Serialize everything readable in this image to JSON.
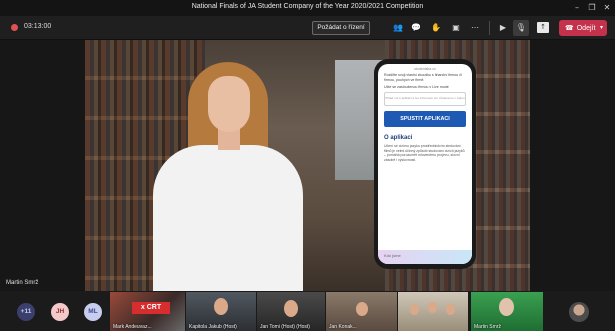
{
  "window": {
    "title": "National Finals of JA Student Company of the Year 2020/2021 Competition",
    "controls": [
      "minimize-icon",
      "restore-icon",
      "close-icon"
    ]
  },
  "toolbar": {
    "timer": "03:13:00",
    "ask_control_label": "Požádat o řízení",
    "leave_label": "Odejít",
    "icons": [
      "participants-icon",
      "chat-icon",
      "raise-hand-icon",
      "rooms-icon",
      "more-icon",
      "camera-off-icon",
      "mic-off-icon",
      "share-screen-icon",
      "phone-icon"
    ],
    "colors": {
      "leave": "#c4314b",
      "recording": "#e05252"
    }
  },
  "stage": {
    "speaker_name": "Martin Smrž"
  },
  "phone": {
    "url": "studentska.cz",
    "intro": "Rozšiřte svoji vlastní zkoušku s finanční firmou či firmou, pouhých ve firmě.",
    "subheading": "Učte se zaslouženou firmou v Live mode",
    "input_placeholder": "Přiřaď mě k aplikaci a tvé informace pro zůstaneme v zájmu",
    "cta_label": "SPUSTIT APLIKACI",
    "section_title": "O aplikaci",
    "section_body": "Učení se cizímu jazyku prostřednictvím sledování filmů je velmi účinný způsob studování cizích jazyků – pomáhá porozumět mluvenému projevu, slovní zásobě i výslovnosti.",
    "footer": "Kdo jsme"
  },
  "participants": {
    "overflow_count": "+11",
    "initials": [
      {
        "text": "JH",
        "bg": "#f4c9c9",
        "fg": "#8a2f2f"
      },
      {
        "text": "ML",
        "bg": "#c7cdef",
        "fg": "#3d4a8f"
      }
    ],
    "tiles": [
      {
        "label": "Mark Andeuvaz...",
        "badge": "x CRT"
      },
      {
        "label": "Kapitola Jakub (Host)"
      },
      {
        "label": "Jan Tomi (Host) (Host)"
      },
      {
        "label": "Jan Konak..."
      },
      {
        "label": ""
      },
      {
        "label": "Martin Smrž"
      }
    ]
  }
}
